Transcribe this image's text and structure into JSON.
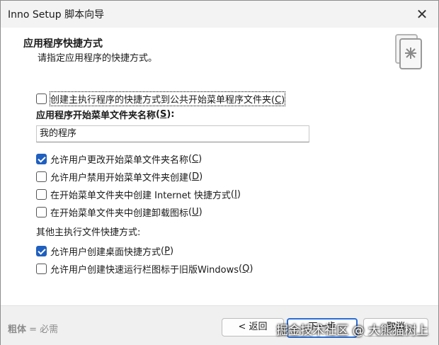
{
  "window": {
    "title": "Inno Setup 脚本向导",
    "close": "✕"
  },
  "header": {
    "title": "应用程序快捷方式",
    "subtitle": "请指定应用程序的快捷方式。"
  },
  "options": {
    "public_shortcut": {
      "text": "创建主执行程序的快捷方式到公共开始菜单程序文件夹",
      "key": "C",
      "checked": false
    },
    "folder_label": {
      "text": "应用程序开始菜单文件夹名称",
      "key": "S",
      "suffix": ":"
    },
    "folder_value": "我的程序",
    "group1": [
      {
        "text": "允许用户更改开始菜单文件夹名称",
        "key": "C",
        "checked": true
      },
      {
        "text": "允许用户禁用开始菜单文件夹创建",
        "key": "D",
        "checked": false
      },
      {
        "text": "在开始菜单文件夹中创建 Internet 快捷方式",
        "key": "I",
        "checked": false
      },
      {
        "text": "在开始菜单文件夹中创建卸载图标",
        "key": "U",
        "checked": false
      }
    ],
    "other_label": "其他主执行文件快捷方式:",
    "group2": [
      {
        "text": "允许用户创建桌面快捷方式",
        "key": "P",
        "checked": true
      },
      {
        "text": "允许用户创建快速运行栏图标于旧版Windows",
        "key": "Q",
        "checked": false
      }
    ]
  },
  "footer": {
    "legend_bold": "粗体",
    "legend_rest": " = 必需",
    "back": "< 返回",
    "next": "下一步",
    "cancel": "取消",
    "watermark": "掘金技术社区 @ 大熊猫树上"
  },
  "colors": {
    "accent": "#1f5fbf",
    "titlebar": "#f3f3f3",
    "footer": "#f0f0f0"
  }
}
